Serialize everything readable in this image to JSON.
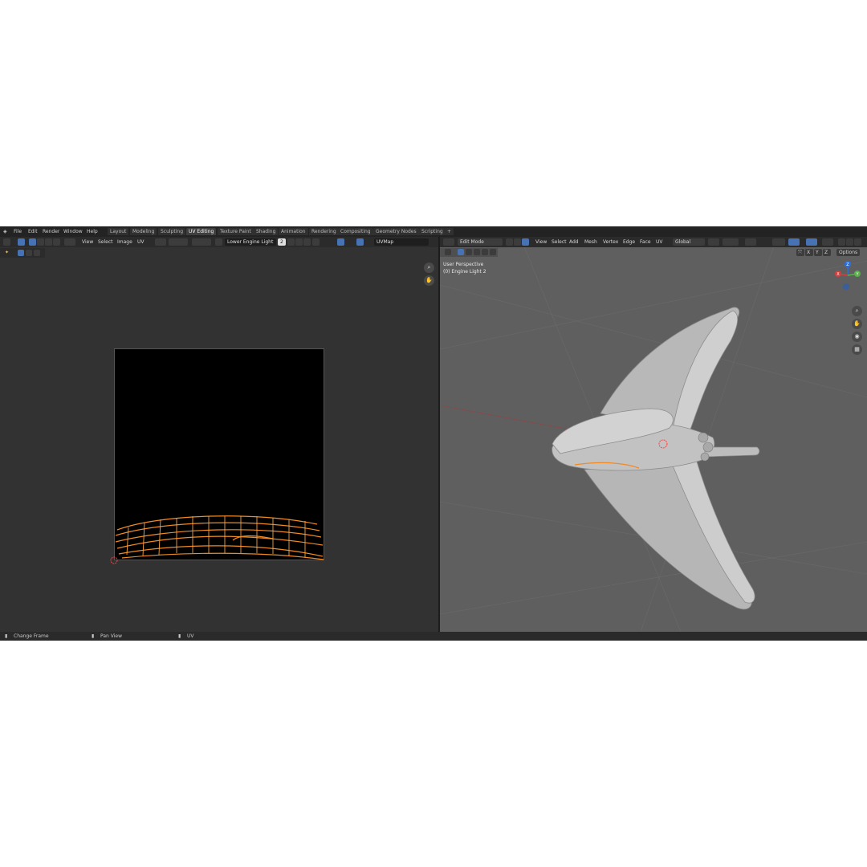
{
  "menu": [
    "File",
    "Edit",
    "Render",
    "Window",
    "Help"
  ],
  "workspaces": [
    "Layout",
    "Modeling",
    "Sculpting",
    "UV Editing",
    "Texture Paint",
    "Shading",
    "Animation",
    "Rendering",
    "Compositing",
    "Geometry Nodes",
    "Scripting"
  ],
  "active_workspace": "UV Editing",
  "add_workspace": "+",
  "uv_editor": {
    "menus": [
      "View",
      "Select",
      "Image",
      "UV"
    ],
    "image_name": "Lower Engine Light",
    "users": "2",
    "uv_map": "UVMap"
  },
  "viewport": {
    "mode": "Edit Mode",
    "menus": [
      "View",
      "Select",
      "Add",
      "Mesh",
      "Vertex",
      "Edge",
      "Face",
      "UV"
    ],
    "orientation": "Global",
    "options": "Options",
    "axes": [
      "X",
      "Y",
      "Z"
    ],
    "perspective": "User Perspective",
    "object": "(0) Engine Light 2",
    "gizmo": {
      "z": "Z",
      "y": "Y",
      "x": "X"
    }
  },
  "status": [
    "Change Frame",
    "Pan View",
    "UV"
  ],
  "colors": {
    "accent": "#4772b3",
    "uv_edge": "#f08a24",
    "mesh": "#c8c8c8"
  }
}
